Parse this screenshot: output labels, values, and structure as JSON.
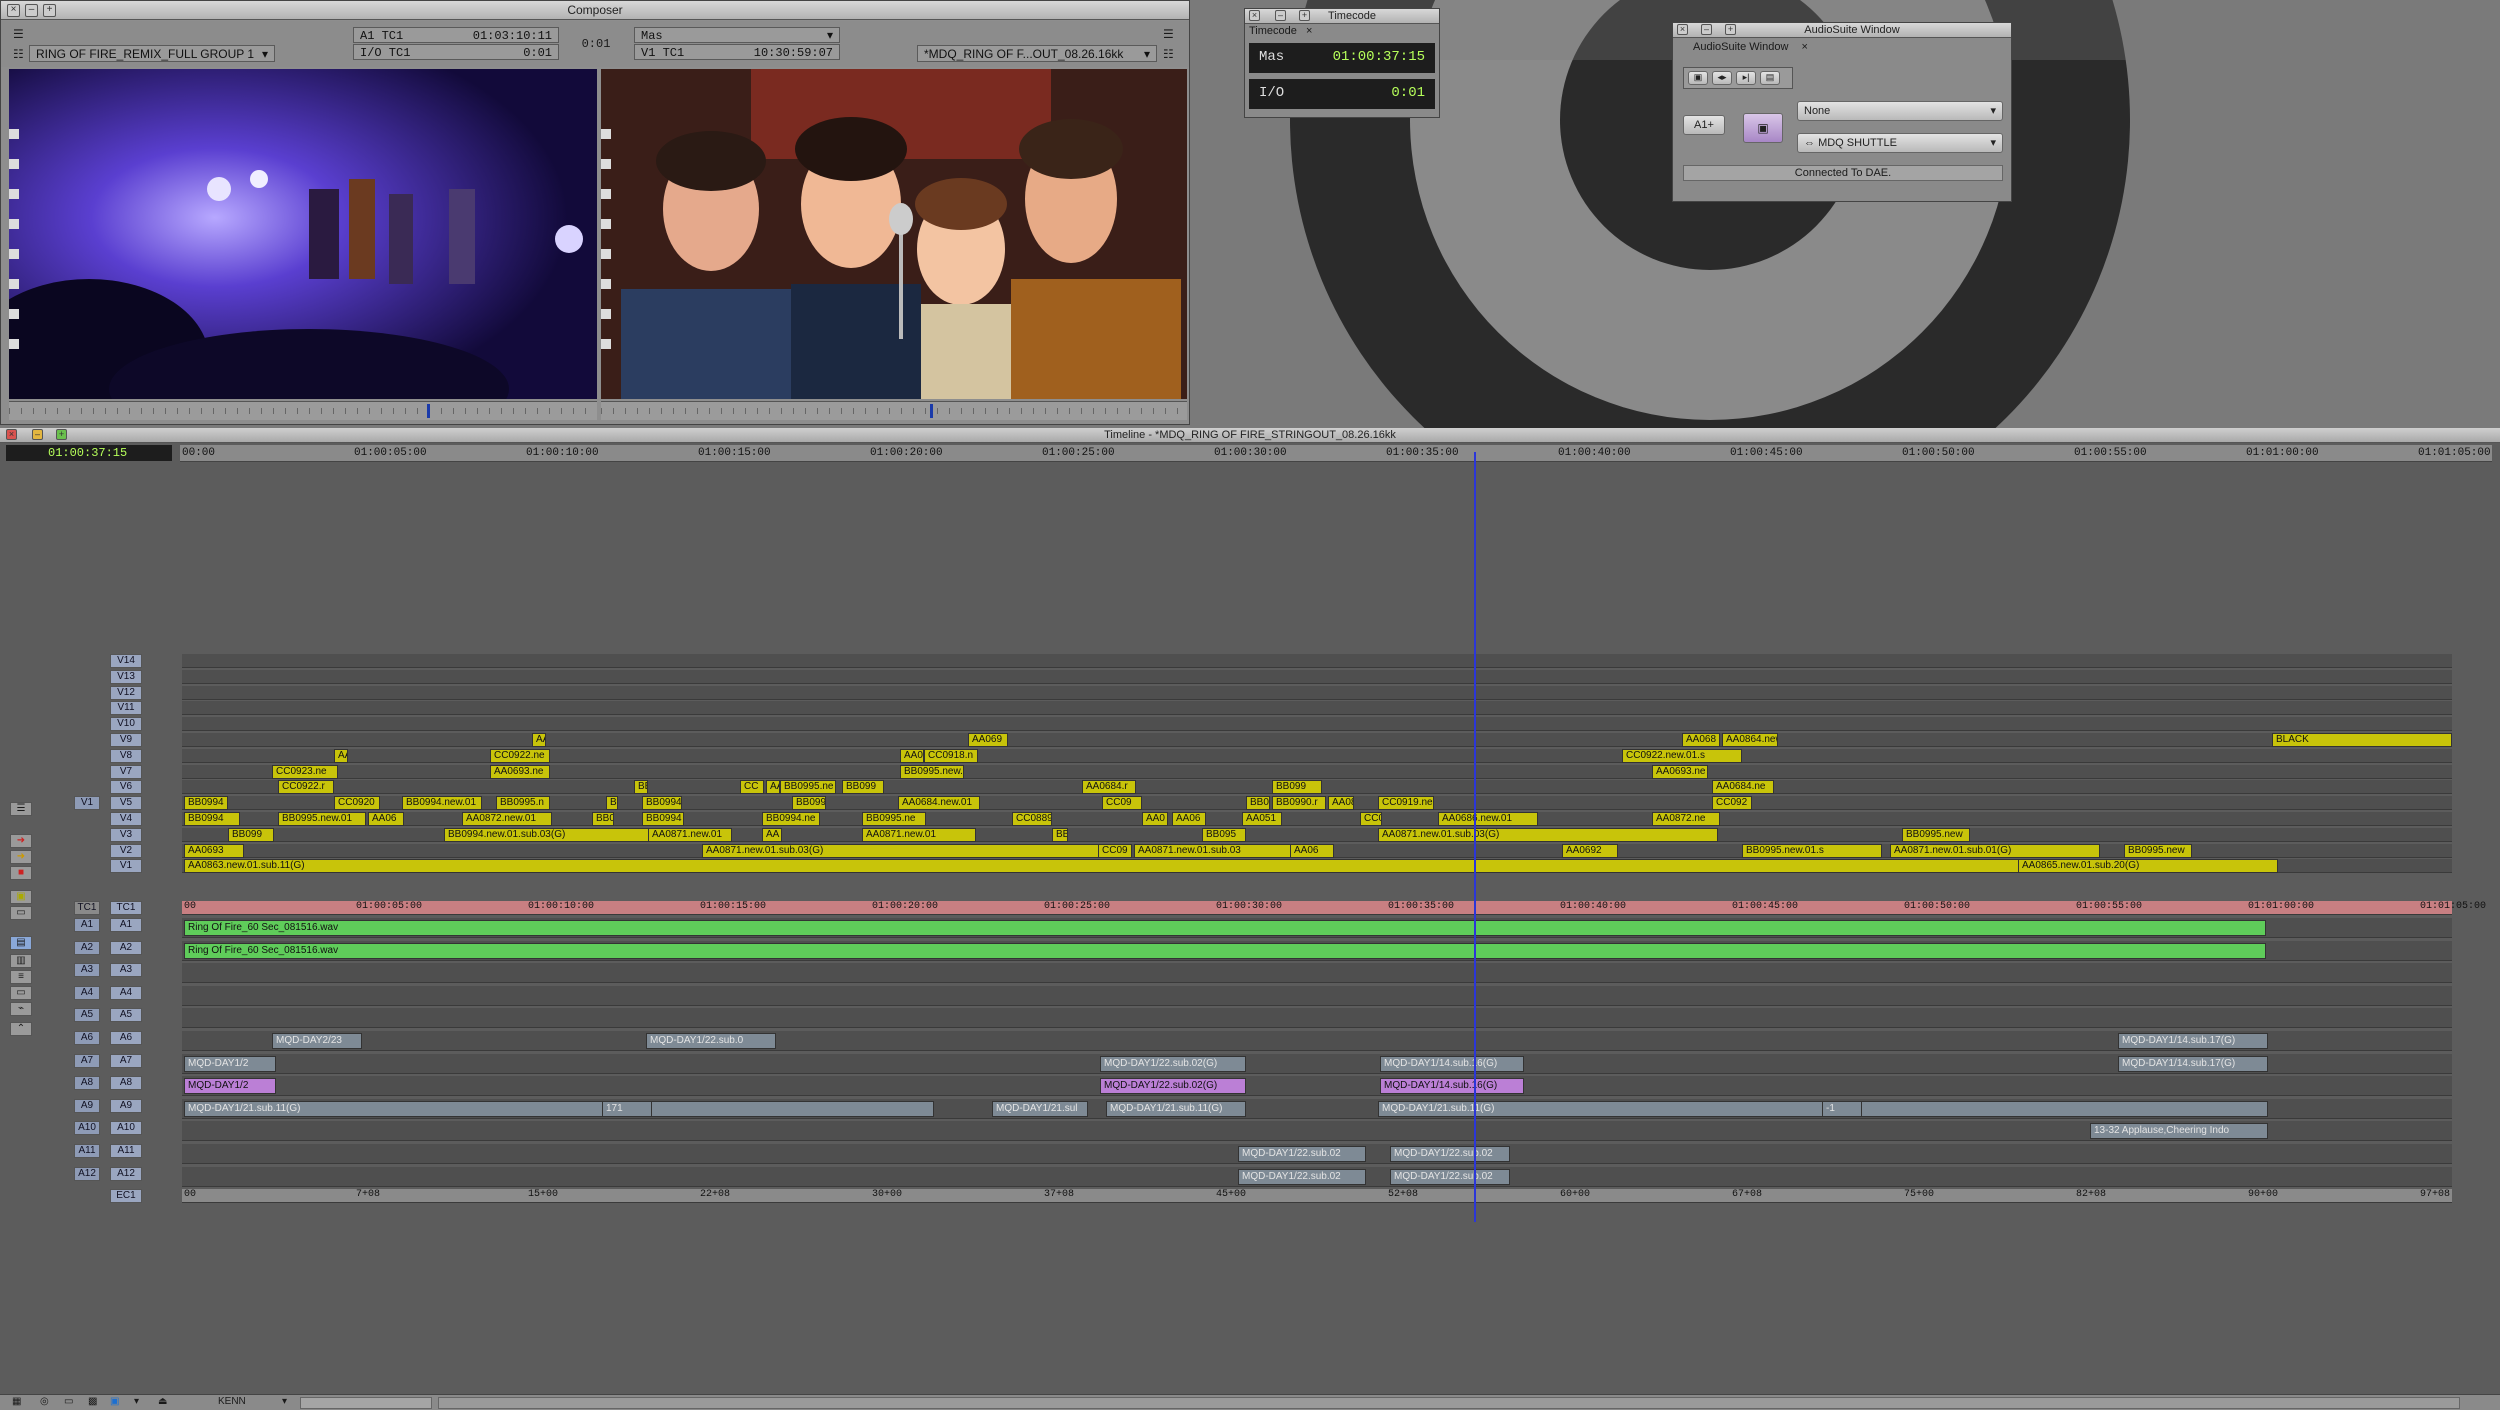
{
  "composer": {
    "title": "Composer",
    "left_sequence": "RING OF FIRE_REMIX_FULL GROUP 1",
    "tc_rows": [
      {
        "label": "A1 TC1",
        "value": "01:03:10:11"
      },
      {
        "label": "I/O TC1",
        "value": "0:01"
      }
    ],
    "center_value": "0:01",
    "right_rows": [
      {
        "label": "Mas",
        "value": ""
      },
      {
        "label": "V1 TC1",
        "value": "10:30:59:07"
      }
    ],
    "right_sequence": "*MDQ_RING OF F...OUT_08.26.16kk"
  },
  "timecode_window": {
    "title": "Timecode",
    "tab": "Timecode",
    "rows": [
      {
        "label": "Mas",
        "value": "01:00:37:15"
      },
      {
        "label": "I/O",
        "value": "0:01"
      }
    ]
  },
  "audiosuite": {
    "title": "AudioSuite Window",
    "tab": "AudioSuite Window",
    "track_button": "A1+",
    "plugin": "None",
    "device": "MDQ SHUTTLE",
    "status": "Connected To DAE."
  },
  "timeline": {
    "title": "Timeline - *MDQ_RING OF FIRE_STRINGOUT_08.26.16kk",
    "current_tc": "01:00:37:15",
    "ruler_labels": [
      "00:00",
      "01:00:05:00",
      "01:00:10:00",
      "01:00:15:00",
      "01:00:20:00",
      "01:00:25:00",
      "01:00:30:00",
      "01:00:35:00",
      "01:00:40:00",
      "01:00:45:00",
      "01:00:50:00",
      "01:00:55:00",
      "01:01:00:00",
      "01:01:05:00"
    ],
    "tc_track_labels": [
      "00",
      "01:00:05:00",
      "01:00:10:00",
      "01:00:15:00",
      "01:00:20:00",
      "01:00:25:00",
      "01:00:30:00",
      "01:00:35:00",
      "01:00:40:00",
      "01:00:45:00",
      "01:00:50:00",
      "01:00:55:00",
      "01:01:00:00",
      "01:01:05:00"
    ],
    "ec_labels": [
      "00",
      "7+08",
      "15+00",
      "22+08",
      "30+00",
      "37+08",
      "45+00",
      "52+08",
      "60+00",
      "67+08",
      "75+00",
      "82+08",
      "90+00",
      "97+08"
    ],
    "video_tracks": [
      "V14",
      "V13",
      "V12",
      "V11",
      "V10",
      "V9",
      "V8",
      "V7",
      "V6",
      "V5",
      "V4",
      "V3",
      "V2",
      "V1"
    ],
    "tc_label": "TC1",
    "audio_tracks": [
      "A1",
      "A2",
      "A3",
      "A4",
      "A5",
      "A6",
      "A7",
      "A8",
      "A9",
      "A10",
      "A11",
      "A12"
    ],
    "ec_label": "EC1",
    "record_video": "V1",
    "clips": {
      "v9": [
        "AA0",
        "AA069",
        "AA068",
        "AA0864.new",
        "BLACK"
      ],
      "v8": [
        "AA",
        "CC0922.ne",
        "AA0",
        "CC0918.n",
        "CC0922.new.01.s"
      ],
      "v7": [
        "CC0923.ne",
        "AA0693.ne",
        "BB0995.new.01",
        "AA0693.ne"
      ],
      "v6": [
        "CC0922.r",
        "BB",
        "CC",
        "AA",
        "BB0995.ne",
        "BB099",
        "AA0684.r",
        "BB099",
        "AA0684.ne"
      ],
      "v5": [
        "BB0994",
        "CC0920",
        "BB0994.new.01",
        "BB0995.n",
        "BB",
        "BB0994",
        "BB099",
        "AA0684.new.01",
        "CC09",
        "BB09",
        "BB0990.r",
        "AA08",
        "CC0919.ne",
        "CC092"
      ],
      "v4": [
        "BB0994",
        "BB0995.new.01",
        "AA06",
        "AA0872.new.01",
        "BB0",
        "BB0994",
        "BB0994.ne",
        "BB0995.ne",
        "CC0889.ne",
        "AA0",
        "AA06",
        "AA051",
        "CC0",
        "AA0686.new.01",
        "AA0872.ne"
      ],
      "v3": [
        "BB099",
        "BB0994.new.01.sub.03(G)",
        "AA0871.new.01",
        "AA",
        "AA0871.new.01",
        "BB0",
        "BB095",
        "AA0871.new.01.sub.03(G)",
        "BB0995.new"
      ],
      "v2": [
        "AA0693",
        "AA0871.new.01.sub.03(G)",
        "CC09",
        "AA0871.new.01.sub.03",
        "AA06",
        "AA0692",
        "BB0995.new.01.s",
        "AA0871.new.01.sub.01(G)",
        "BB0995.new"
      ],
      "v1": [
        "AA0863.new.01.sub.11(G)",
        "AA0865.new.01.sub.20(G)"
      ],
      "a1": "Ring Of Fire_60 Sec_081516.wav",
      "a2": "Ring Of Fire_60 Sec_081516.wav",
      "a6": [
        "MQD-DAY2/23",
        "MQD-DAY1/22.sub.0",
        "MQD-DAY1/14.sub.17(G)"
      ],
      "a7": [
        "MQD-DAY1/2",
        "MQD-DAY1/22.sub.02(G)",
        "MQD-DAY1/14.sub.16(G)",
        "MQD-DAY1/14.sub.17(G)"
      ],
      "a8": [
        "MQD-DAY1/2",
        "MQD-DAY1/22.sub.02(G)",
        "MQD-DAY1/14.sub.16(G)"
      ],
      "a9": [
        "MQD-DAY1/21.sub.11(G)",
        "171",
        "MQD-DAY1/21.sul",
        "MQD-DAY1/21.sub.11(G)",
        "MQD-DAY1/21.sub.11(G)",
        "-1"
      ],
      "a10": "13-32 Applause,Cheering Indo",
      "a11": [
        "MQD-DAY1/22.sub.02",
        "MQD-DAY1/22.sub.02"
      ],
      "a12": [
        "MQD-DAY1/22.sub.02",
        "MQD-DAY1/22.sub.02"
      ]
    }
  },
  "statusbar": {
    "user": "KENN"
  },
  "colors": {
    "video_clip": "#c8c40a",
    "audio_clip": "#5fcc5a",
    "grey_clip": "#7e8a95",
    "purple_clip": "#bb7fd6",
    "playhead": "#2b36d9",
    "tc_track": "#c87f82"
  }
}
